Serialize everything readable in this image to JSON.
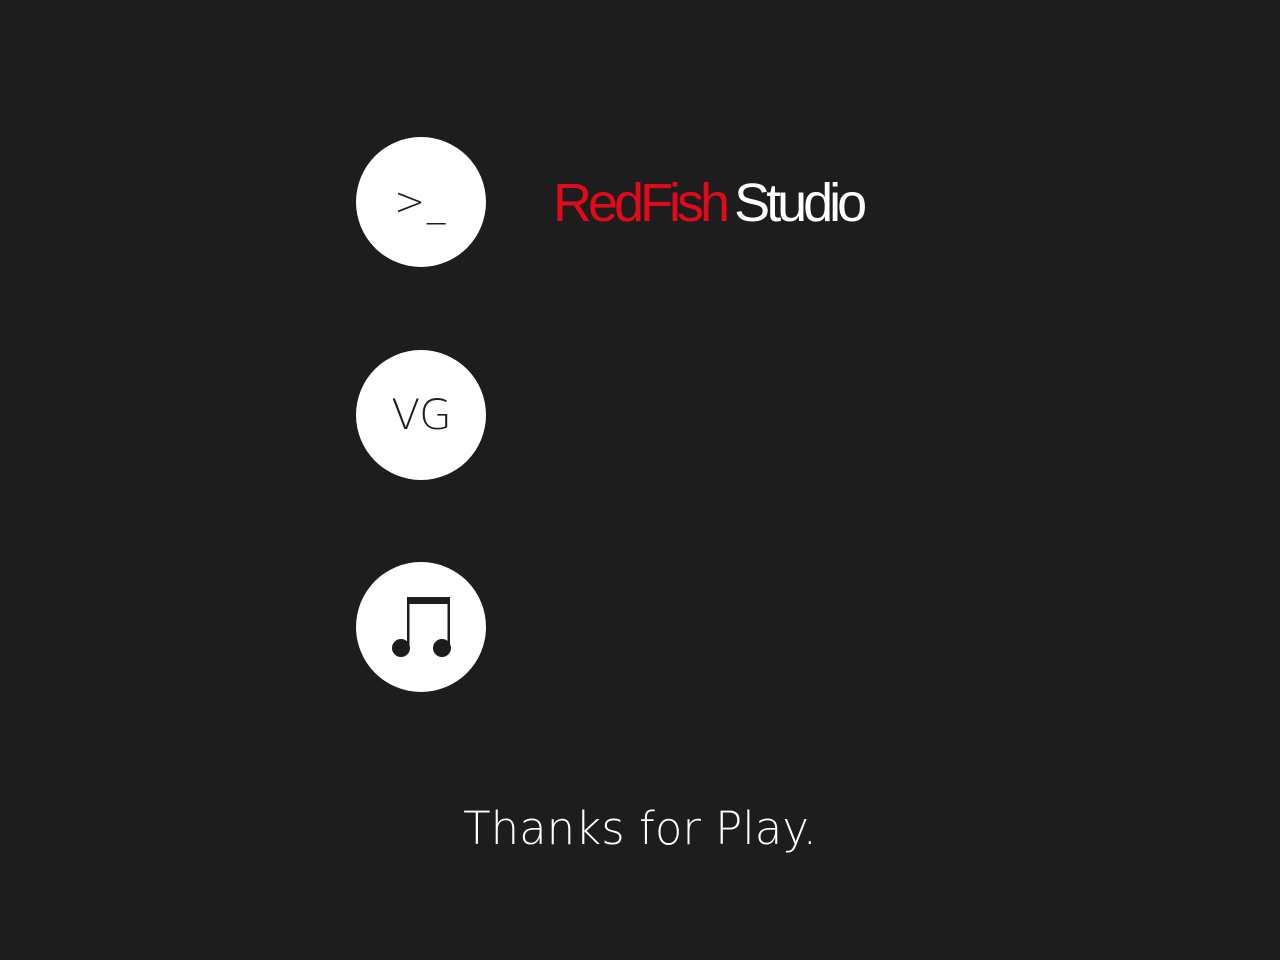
{
  "buttons": {
    "console": {
      "label": ">_",
      "icon": "console-prompt-icon"
    },
    "vg": {
      "label": "VG"
    },
    "music": {
      "icon": "music-note-icon"
    }
  },
  "logo": {
    "part1": "RedFish",
    "part2": "Studio",
    "colors": {
      "part1": "#e2091a",
      "part2": "#ffffff"
    }
  },
  "footer": {
    "message": "Thanks for Play."
  },
  "theme": {
    "background": "#1d1d1d",
    "circle": "#ffffff"
  }
}
